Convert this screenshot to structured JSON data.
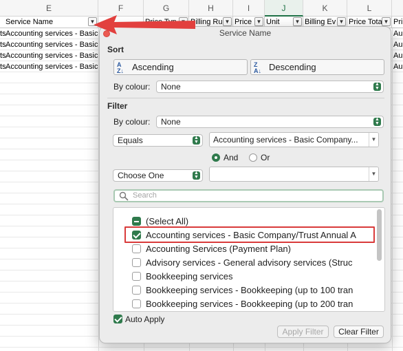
{
  "sheet": {
    "column_letters": [
      "E",
      "F",
      "G",
      "H",
      "I",
      "J",
      "K",
      "L"
    ],
    "selected_column": "J",
    "headers": [
      "Service Name",
      "",
      "Price Typ",
      "Billing Ru",
      "Price",
      "Unit",
      "Billing Ev",
      "Price Tota",
      "Pri"
    ],
    "rows": [
      "Accounting services - Basic C",
      "Accounting services - Basic C",
      "Accounting services - Basic C",
      "Accounting services - Basic C"
    ],
    "left_clip": [
      "ts",
      "ts",
      "ts",
      "ts"
    ],
    "right_clip": [
      "Au",
      "Au",
      "Au",
      "Au"
    ]
  },
  "popover": {
    "title": "Service Name",
    "sort": {
      "heading": "Sort",
      "ascending_label": "Ascending",
      "descending_label": "Descending",
      "by_colour_label": "By colour:",
      "by_colour_value": "None"
    },
    "filter": {
      "heading": "Filter",
      "by_colour_label": "By colour:",
      "by_colour_value": "None",
      "condition1_operator": "Equals",
      "condition1_value": "Accounting services - Basic Company...",
      "and_label": "And",
      "or_label": "Or",
      "logic_selected": "And",
      "condition2_operator": "Choose One",
      "condition2_value": ""
    },
    "search_placeholder": "Search",
    "items": [
      {
        "label": "(Select All)",
        "state": "mixed"
      },
      {
        "label": "Accounting services - Basic Company/Trust Annual A",
        "state": "checked"
      },
      {
        "label": "Accounting Services (Payment Plan)",
        "state": "unchecked"
      },
      {
        "label": "Advisory services - General advisory services (Struc",
        "state": "unchecked"
      },
      {
        "label": "Bookkeeping services",
        "state": "unchecked"
      },
      {
        "label": "Bookkeeping services - Bookkeeping (up to 100 tran",
        "state": "unchecked"
      },
      {
        "label": "Bookkeeping services - Bookkeeping (up to 200 tran",
        "state": "unchecked"
      }
    ],
    "auto_apply_label": "Auto Apply",
    "auto_apply_checked": true,
    "apply_button": "Apply Filter",
    "clear_button": "Clear Filter"
  },
  "colors": {
    "accent": "#2f7a4c",
    "highlight_red": "#d93a3a",
    "arrow_red": "#e2403e"
  },
  "icons": {
    "filter_button": "filter-funnel-icon",
    "sort_asc": "sort-ascending-icon",
    "sort_desc": "sort-descending-icon",
    "search": "search-icon",
    "close": "close-dot-icon"
  }
}
